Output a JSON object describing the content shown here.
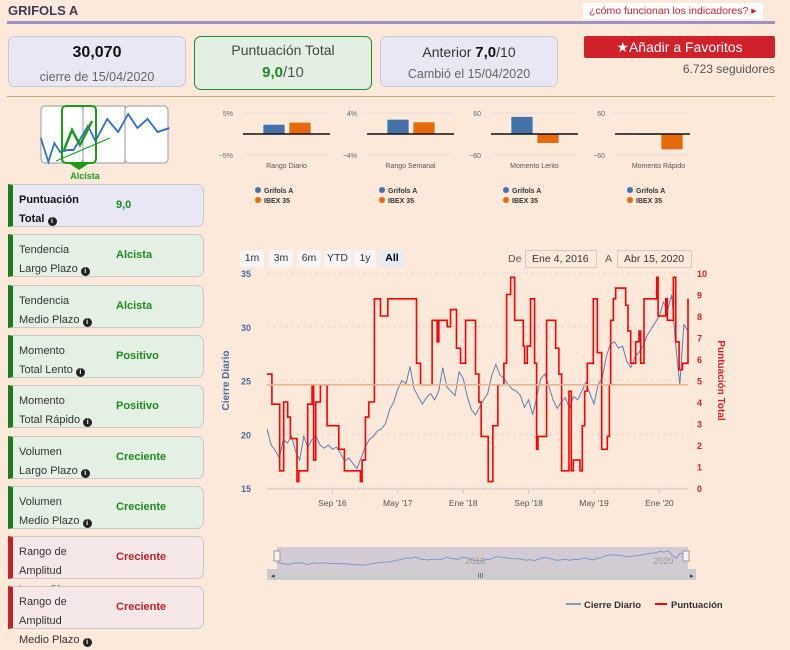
{
  "header": {
    "title": "GRIFOLS A",
    "how_link": "¿cómo funcionan los indicadores? ▸"
  },
  "summary": {
    "price": "30,070",
    "price_sub": "cierre de 15/04/2020",
    "score_label": "Puntuación Total",
    "score_value": "9,0",
    "score_max": "/10",
    "prev_label": "Anterior ",
    "prev_value": "7,0",
    "prev_max": "/10",
    "prev_sub": "Cambió el 15/04/2020"
  },
  "favorites": {
    "label": "Añadir a Favoritos",
    "icon": "star-icon",
    "followers": "6.723 seguidores"
  },
  "trend": {
    "label": "Alcista"
  },
  "indicators": [
    {
      "title1": "Puntuación",
      "title2": "Total",
      "value": "9,0",
      "status": "green"
    },
    {
      "title1": "Tendencia",
      "title2": "Largo Plazo",
      "value": "Alcista",
      "status": "green"
    },
    {
      "title1": "Tendencia",
      "title2": "Medio Plazo",
      "value": "Alcista",
      "status": "green"
    },
    {
      "title1": "Momento",
      "title2": "Total Lento",
      "value": "Positivo",
      "status": "green"
    },
    {
      "title1": "Momento",
      "title2": "Total Rápido",
      "value": "Positivo",
      "status": "green"
    },
    {
      "title1": "Volumen",
      "title2": "Largo Plazo",
      "value": "Creciente",
      "status": "green"
    },
    {
      "title1": "Volumen",
      "title2": "Medio Plazo",
      "value": "Creciente",
      "status": "green"
    },
    {
      "title1": "Rango de Amplitud",
      "title2": "Largo Plazo",
      "value": "Creciente",
      "status": "red"
    },
    {
      "title1": "Rango de Amplitud",
      "title2": "Medio Plazo",
      "value": "Creciente",
      "status": "red"
    }
  ],
  "colors": {
    "grifols": "#4572a7",
    "ibex": "#e8690b",
    "price_line": "#5b7fb5",
    "score_line": "#ff0000",
    "accent": "#d0202a"
  },
  "range": {
    "buttons": [
      "1m",
      "3m",
      "6m",
      "YTD",
      "1y",
      "All"
    ],
    "selected": "All",
    "from_label": "De",
    "from": "Ene 4, 2016",
    "to_label": "A",
    "to": "Abr 15, 2020"
  },
  "chart_data": [
    {
      "type": "bar",
      "title": "Rango Diario",
      "ylim": [
        -5,
        5
      ],
      "ticks": [
        "5%",
        "−5%"
      ],
      "series": [
        {
          "name": "Grifols A",
          "values": [
            2.3
          ]
        },
        {
          "name": "IBEX 35",
          "values": [
            2.8
          ]
        }
      ]
    },
    {
      "type": "bar",
      "title": "Rango Semanal",
      "ylim": [
        -4,
        4
      ],
      "ticks": [
        "4%",
        "−4%"
      ],
      "series": [
        {
          "name": "Grifols A",
          "values": [
            2.8
          ]
        },
        {
          "name": "IBEX 35",
          "values": [
            2.3
          ]
        }
      ]
    },
    {
      "type": "bar",
      "title": "Momento Lento",
      "ylim": [
        -60,
        60
      ],
      "ticks": [
        "60",
        "−60"
      ],
      "series": [
        {
          "name": "Grifols A",
          "values": [
            50
          ]
        },
        {
          "name": "IBEX 35",
          "values": [
            -27
          ]
        }
      ]
    },
    {
      "type": "bar",
      "title": "Momento Rápido",
      "ylim": [
        -60,
        60
      ],
      "ticks": [
        "60",
        "−60"
      ],
      "series": [
        {
          "name": "Grifols A",
          "values": [
            -3
          ]
        },
        {
          "name": "IBEX 35",
          "values": [
            -45
          ]
        }
      ]
    },
    {
      "type": "line",
      "ylabel_left": "Cierre Diario",
      "ylabel_right": "Puntuación Total",
      "ylim_left": [
        15,
        35
      ],
      "yticks_left": [
        "15",
        "20",
        "25",
        "30",
        "35"
      ],
      "ylim_right": [
        0,
        10
      ],
      "yticks_right": [
        "0",
        "1",
        "2",
        "3",
        "4",
        "5",
        "6",
        "7",
        "8",
        "9",
        "10"
      ],
      "xlim_months": [
        0,
        51.5
      ],
      "xticks": [
        {
          "m": 8,
          "label": "Sep '16"
        },
        {
          "m": 16,
          "label": "May '17"
        },
        {
          "m": 24,
          "label": "Ene '18"
        },
        {
          "m": 32,
          "label": "Sep '18"
        },
        {
          "m": 40,
          "label": "May '19"
        },
        {
          "m": 48,
          "label": "Ene '20"
        }
      ],
      "reference_score": 4.8,
      "legend": [
        "Cierre Diario",
        "Puntuación"
      ],
      "price": [
        [
          0,
          20.5
        ],
        [
          0.5,
          19
        ],
        [
          1,
          18.5
        ],
        [
          1.5,
          17.8
        ],
        [
          2,
          19.5
        ],
        [
          2.5,
          19.2
        ],
        [
          3,
          19.8
        ],
        [
          3.5,
          18.4
        ],
        [
          4,
          17.6
        ],
        [
          4.5,
          19.8
        ],
        [
          5,
          18.8
        ],
        [
          5.5,
          19.5
        ],
        [
          6,
          19.8
        ],
        [
          6.5,
          19
        ],
        [
          7,
          18.7
        ],
        [
          7.5,
          19
        ],
        [
          8,
          18.6
        ],
        [
          8.5,
          18.8
        ],
        [
          9,
          18.2
        ],
        [
          9.5,
          17.5
        ],
        [
          10,
          17.8
        ],
        [
          10.5,
          17.3
        ],
        [
          11,
          16.8
        ],
        [
          11.5,
          17.8
        ],
        [
          12,
          18.8
        ],
        [
          12.5,
          19.5
        ],
        [
          13,
          19.8
        ],
        [
          13.5,
          20.3
        ],
        [
          14,
          20.5
        ],
        [
          14.5,
          21
        ],
        [
          15,
          22.3
        ],
        [
          15.5,
          23
        ],
        [
          16,
          24.2
        ],
        [
          16.5,
          25
        ],
        [
          17,
          24.7
        ],
        [
          17.5,
          26.3
        ],
        [
          18,
          24.2
        ],
        [
          18.5,
          23.5
        ],
        [
          19,
          22.8
        ],
        [
          19.5,
          23.4
        ],
        [
          20,
          23.8
        ],
        [
          20.5,
          23.2
        ],
        [
          21,
          24
        ],
        [
          21.5,
          26.2
        ],
        [
          22,
          24.4
        ],
        [
          22.5,
          24
        ],
        [
          23,
          23.6
        ],
        [
          23.5,
          25.8
        ],
        [
          24,
          25.2
        ],
        [
          24.5,
          23.5
        ],
        [
          25,
          22.3
        ],
        [
          25.5,
          21.8
        ],
        [
          26,
          22.5
        ],
        [
          26.5,
          23.2
        ],
        [
          27,
          23.8
        ],
        [
          27.5,
          25.5
        ],
        [
          28,
          26.5
        ],
        [
          28.5,
          25.5
        ],
        [
          29,
          25.2
        ],
        [
          29.5,
          24.6
        ],
        [
          30,
          24.2
        ],
        [
          30.5,
          24
        ],
        [
          31,
          23.6
        ],
        [
          31.5,
          22.5
        ],
        [
          32,
          23.2
        ],
        [
          32.5,
          21.8
        ],
        [
          33,
          23.5
        ],
        [
          33.5,
          25.2
        ],
        [
          34,
          25.6
        ],
        [
          34.5,
          24.4
        ],
        [
          35,
          23.2
        ],
        [
          35.5,
          22.4
        ],
        [
          36,
          23
        ],
        [
          36.5,
          23.4
        ],
        [
          37,
          22.4
        ],
        [
          37.5,
          23.5
        ],
        [
          38,
          23.2
        ],
        [
          38.5,
          24
        ],
        [
          39,
          24.8
        ],
        [
          39.5,
          23.8
        ],
        [
          40,
          22.8
        ],
        [
          40.5,
          24.6
        ],
        [
          41,
          25.2
        ],
        [
          41.5,
          27.2
        ],
        [
          42,
          28.4
        ],
        [
          42.5,
          28.6
        ],
        [
          43,
          28
        ],
        [
          43.5,
          28.2
        ],
        [
          44,
          26.8
        ],
        [
          44.5,
          26.2
        ],
        [
          45,
          27.2
        ],
        [
          45.5,
          27.6
        ],
        [
          46,
          28.2
        ],
        [
          46.5,
          29.2
        ],
        [
          47,
          29.8
        ],
        [
          47.5,
          30.4
        ],
        [
          48,
          31
        ],
        [
          48.5,
          32.3
        ],
        [
          49,
          31.5
        ],
        [
          49.5,
          33
        ],
        [
          50,
          28.2
        ],
        [
          50.5,
          24.6
        ],
        [
          51,
          30.2
        ],
        [
          51.5,
          29.6
        ]
      ],
      "score": [
        [
          0,
          5.3
        ],
        [
          0.6,
          3.9
        ],
        [
          1.55,
          0.8
        ],
        [
          2.04,
          4
        ],
        [
          2.53,
          3.3
        ],
        [
          2.86,
          2.3
        ],
        [
          3.67,
          0.3
        ],
        [
          3.88,
          0.8
        ],
        [
          4.98,
          3.9
        ],
        [
          5.51,
          4.8
        ],
        [
          5.71,
          1.3
        ],
        [
          5.96,
          4
        ],
        [
          6.53,
          4.8
        ],
        [
          7.35,
          2.9
        ],
        [
          8.78,
          1.8
        ],
        [
          9.47,
          0.8
        ],
        [
          11.43,
          0.3
        ],
        [
          11.63,
          1.3
        ],
        [
          12.04,
          3.3
        ],
        [
          12.45,
          4
        ],
        [
          13.14,
          8.8
        ],
        [
          13.88,
          8
        ],
        [
          14.78,
          8.8
        ],
        [
          18.29,
          5.8
        ],
        [
          18.78,
          4.8
        ],
        [
          20.2,
          7.8
        ],
        [
          20.82,
          6.8
        ],
        [
          21.02,
          7.8
        ],
        [
          22.04,
          7.5
        ],
        [
          22.45,
          8.3
        ],
        [
          23.18,
          6.5
        ],
        [
          23.67,
          5.8
        ],
        [
          24.29,
          7.8
        ],
        [
          25.51,
          5.3
        ],
        [
          25.92,
          4
        ],
        [
          26.2,
          2.4
        ],
        [
          27.06,
          0.3
        ],
        [
          27.63,
          2.9
        ],
        [
          28.24,
          4.8
        ],
        [
          28.98,
          5.8
        ],
        [
          29.31,
          9
        ],
        [
          29.8,
          9.8
        ],
        [
          30.29,
          7.8
        ],
        [
          31.35,
          6.6
        ],
        [
          31.51,
          5.8
        ],
        [
          31.84,
          6.6
        ],
        [
          32.24,
          8.8
        ],
        [
          32.73,
          5.8
        ],
        [
          32.98,
          1.8
        ],
        [
          33.14,
          2.4
        ],
        [
          34.2,
          7.8
        ],
        [
          35.31,
          6.5
        ],
        [
          35.71,
          5.3
        ],
        [
          36.04,
          0.8
        ],
        [
          36.94,
          4.5
        ],
        [
          37.22,
          0.8
        ],
        [
          37.47,
          1.3
        ],
        [
          38.29,
          0.8
        ],
        [
          38.57,
          2.9
        ],
        [
          38.86,
          4.5
        ],
        [
          39.18,
          5.8
        ],
        [
          39.92,
          8.8
        ],
        [
          40.41,
          6.3
        ],
        [
          40.94,
          1.8
        ],
        [
          41.63,
          2.4
        ],
        [
          41.88,
          4.8
        ],
        [
          42.04,
          7.8
        ],
        [
          42.37,
          8.8
        ],
        [
          42.65,
          9.3
        ],
        [
          43.88,
          8.5
        ],
        [
          44.16,
          7.3
        ],
        [
          44.49,
          5.8
        ],
        [
          45.1,
          6.8
        ],
        [
          45.51,
          7.3
        ],
        [
          45.71,
          5.8
        ],
        [
          46.12,
          8.8
        ],
        [
          47.67,
          9.8
        ],
        [
          47.84,
          8
        ],
        [
          48.78,
          8.8
        ],
        [
          48.98,
          7.8
        ],
        [
          49.71,
          9.8
        ],
        [
          50,
          6.8
        ],
        [
          50.41,
          5.5
        ],
        [
          50.82,
          5.8
        ],
        [
          51.5,
          8.8
        ]
      ],
      "navigator_labels": [
        "2018",
        "2020"
      ]
    }
  ]
}
